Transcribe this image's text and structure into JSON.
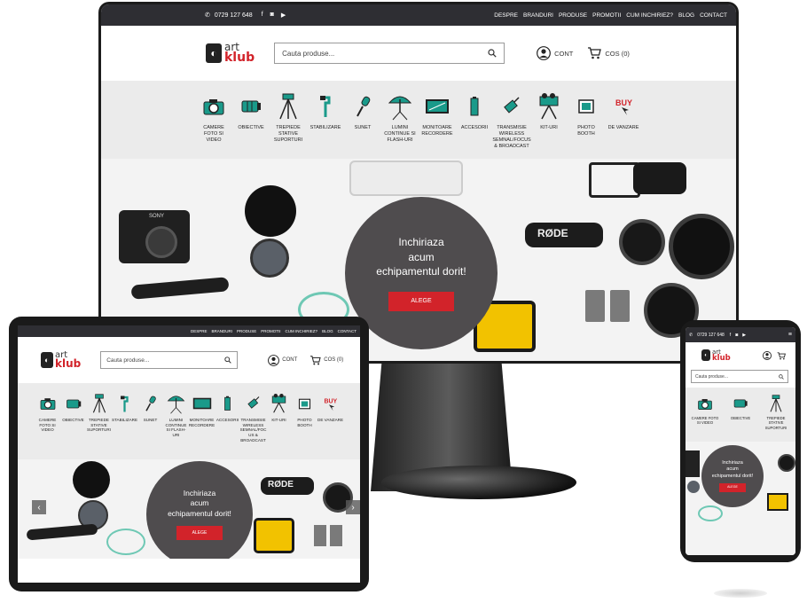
{
  "site": {
    "phone": "0729 127 648",
    "social_icons": [
      "facebook-icon",
      "instagram-icon",
      "youtube-icon"
    ],
    "nav": [
      "DESPRE",
      "BRANDURI",
      "PRODUSE",
      "PROMOTII",
      "CUM INCHIRIEZ?",
      "BLOG",
      "CONTACT"
    ],
    "logo": {
      "line1": "art",
      "line2": "klub"
    },
    "search_placeholder": "Cauta produse...",
    "account_label": "CONT",
    "cart_label": "COS (0)",
    "categories": [
      {
        "label": "CAMERE FOTO SI VIDEO",
        "icon": "camera-icon"
      },
      {
        "label": "OBIECTIVE",
        "icon": "lens-icon"
      },
      {
        "label": "TREPIEDE STATIVE SUPORTURI",
        "icon": "tripod-icon"
      },
      {
        "label": "STABILIZARE",
        "icon": "gimbal-icon"
      },
      {
        "label": "SUNET",
        "icon": "microphone-icon"
      },
      {
        "label": "LUMINI CONTINUE SI FLASH-URI",
        "icon": "umbrella-light-icon"
      },
      {
        "label": "MONITOARE RECORDERE",
        "icon": "monitor-icon"
      },
      {
        "label": "ACCESORII",
        "icon": "battery-icon"
      },
      {
        "label": "TRANSMISIE WIRELESS SEMNAL/FOCUS & BROADCAST",
        "icon": "wireless-icon"
      },
      {
        "label": "KIT-URI",
        "icon": "camera-kit-icon"
      },
      {
        "label": "PHOTO BOOTH",
        "icon": "photo-booth-icon"
      },
      {
        "label": "DE VANZARE",
        "icon": "buy-icon"
      }
    ],
    "tablet_category_labels": [
      "CAMERE FOTO SI VIDEO",
      "OBIECTIVE",
      "TREPIEDE STATIVE SUPORTURI",
      "STABILIZARE",
      "SUNET",
      "LUMINI CONTINUE SI FLASH-URI",
      "MONITOARE RECORDERE",
      "ACCESORII",
      "TRANSMISIE WIRELESS SEMNAL/FOC US & BROADCAST",
      "KIT-URI",
      "PHOTO BOOTH",
      "DE VANZARE"
    ],
    "phone_category_labels": [
      "CAMERE FOTO SI VIDEO",
      "OBIECTIVE",
      "TREPIEDE STATIVE SUPORTURI"
    ],
    "hero": {
      "line1": "Inchiriaza",
      "line2": "acum",
      "line3": "echipamentul dorit!",
      "button": "ALEGE",
      "mic_brand": "RØDE",
      "camera_brand": "SONY"
    },
    "colors": {
      "accent": "#d2232a",
      "teal": "#1a9a8a",
      "topbar": "#2e2e33",
      "circle": "#4f4c4e"
    }
  }
}
